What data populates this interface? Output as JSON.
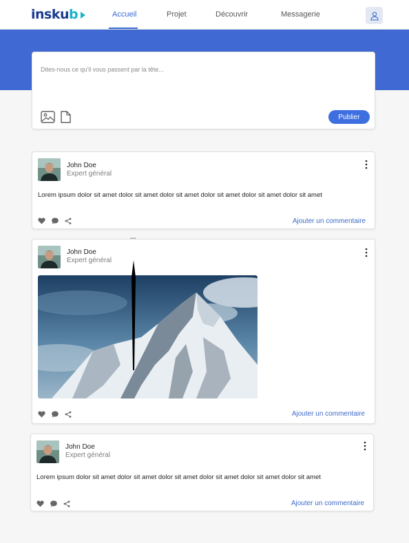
{
  "brand": {
    "logo_text_main": "insku",
    "logo_text_end": "b"
  },
  "nav": {
    "items": [
      {
        "label": "Accueil",
        "active": true
      },
      {
        "label": "Projet",
        "active": false
      },
      {
        "label": "Découvrir",
        "active": false
      },
      {
        "label": "Messagerie",
        "active": false
      }
    ],
    "profile_icon": "user-icon"
  },
  "composer": {
    "placeholder": "Dites-nous ce qu'il vous passent par la tête...",
    "tools": [
      "image-icon",
      "file-icon"
    ],
    "publish_label": "Publier"
  },
  "posts": [
    {
      "author": "John Doe",
      "role": "Expert général",
      "text": "Lorem ipsum dolor sit amet dolor sit amet dolor sit amet dolor sit amet dolor sit amet dolor sit amet",
      "actions": [
        "heart-icon",
        "comment-icon",
        "share-icon"
      ],
      "comment_label": "Ajouter un commentaire"
    },
    {
      "author": "John Doe",
      "role": "Expert général",
      "image": "mountain-photo",
      "actions": [
        "heart-icon",
        "comment-icon",
        "share-icon"
      ],
      "comment_label": "Ajouter un commentaire"
    },
    {
      "author": "John Doe",
      "role": "Expert général",
      "text": "Lorem ipsum dolor sit amet dolor sit amet dolor sit amet dolor sit amet dolor sit amet dolor sit amet",
      "actions": [
        "heart-icon",
        "comment-icon",
        "share-icon"
      ],
      "comment_label": "Ajouter un commentaire"
    }
  ],
  "colors": {
    "primary": "#3569d2",
    "hero": "#4169d3",
    "button": "#3e6fe0",
    "link": "#3c6ac8"
  }
}
